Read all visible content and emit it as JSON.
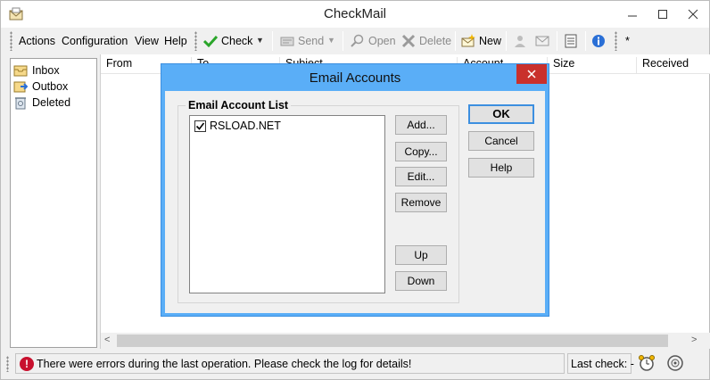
{
  "window": {
    "title": "CheckMail"
  },
  "menu": {
    "actions": "Actions",
    "configuration": "Configuration",
    "view": "View",
    "help": "Help"
  },
  "toolbar": {
    "check": "Check",
    "send": "Send",
    "open": "Open",
    "delete": "Delete",
    "new": "New",
    "asterisk": "*"
  },
  "folders": [
    {
      "label": "Inbox",
      "icon": "inbox-icon"
    },
    {
      "label": "Outbox",
      "icon": "outbox-icon"
    },
    {
      "label": "Deleted",
      "icon": "deleted-icon"
    }
  ],
  "columns": [
    "From",
    "To",
    "Subject",
    "Account",
    "Size",
    "Received"
  ],
  "status": {
    "message": "There were errors during the last operation. Please check the log for details!",
    "last_check": "Last check: -"
  },
  "dialog": {
    "title": "Email Accounts",
    "group_label": "Email Account List",
    "accounts": [
      {
        "label": "RSLOAD.NET",
        "checked": true
      }
    ],
    "buttons": {
      "add": "Add...",
      "copy": "Copy...",
      "edit": "Edit...",
      "remove": "Remove",
      "up": "Up",
      "down": "Down",
      "ok": "OK",
      "cancel": "Cancel",
      "help": "Help"
    }
  },
  "colors": {
    "dialog_accent": "#5aaef7",
    "close_red": "#c9302c",
    "error_red": "#c8102e",
    "check_green": "#2aa52a"
  }
}
